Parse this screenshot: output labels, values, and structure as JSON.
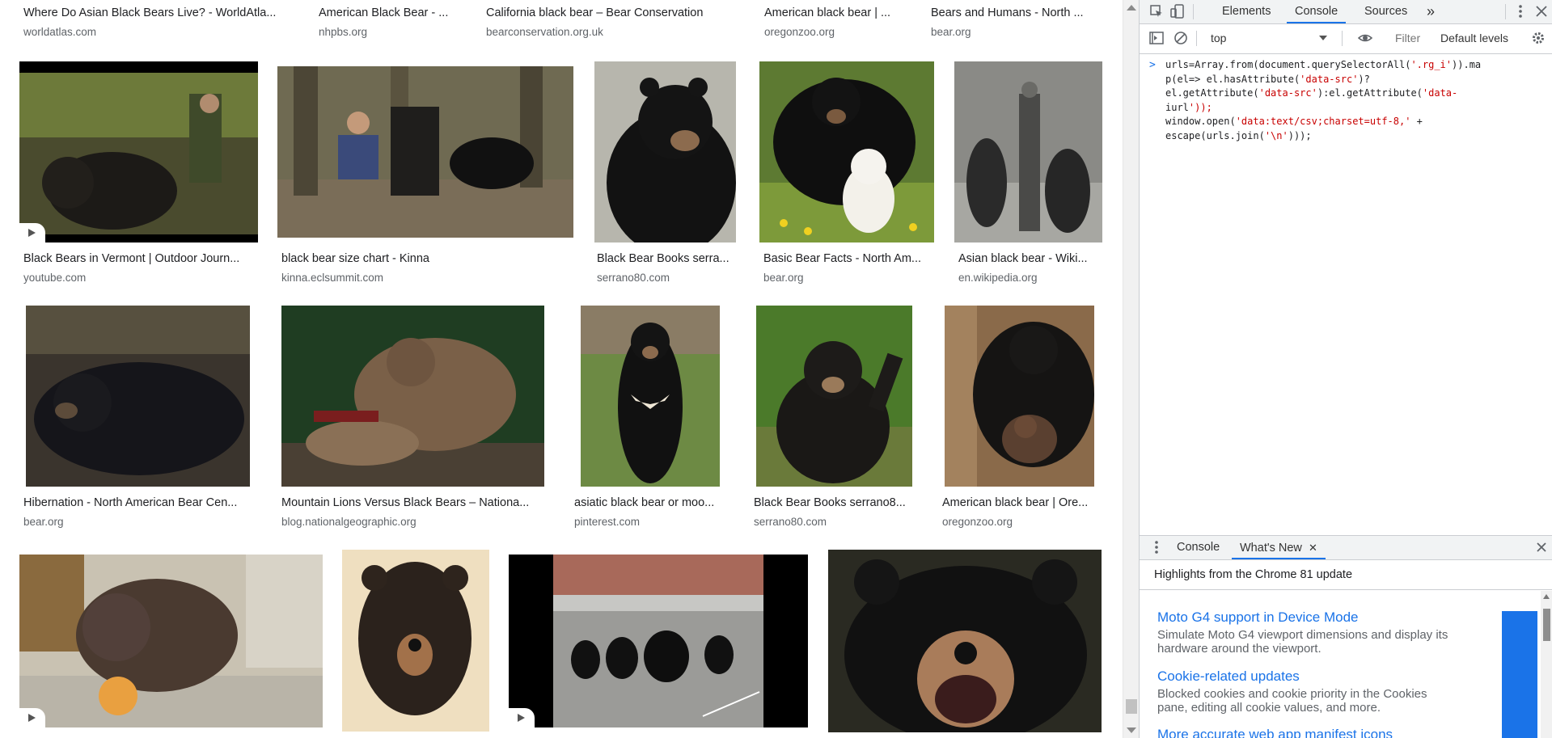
{
  "top_row": [
    {
      "title": "Where Do Asian Black Bears Live? - WorldAtla...",
      "domain": "worldatlas.com"
    },
    {
      "title": "American Black Bear - ...",
      "domain": "nhpbs.org"
    },
    {
      "title": "California black bear – Bear Conservation",
      "domain": "bearconservation.org.uk"
    },
    {
      "title": "American black bear | ...",
      "domain": "oregonzoo.org"
    },
    {
      "title": "Bears and Humans - North ...",
      "domain": "bear.org"
    }
  ],
  "row1": [
    {
      "title": "Black Bears in Vermont | Outdoor Journ...",
      "domain": "youtube.com",
      "video": true
    },
    {
      "title": "black bear size chart - Kinna",
      "domain": "kinna.eclsummit.com"
    },
    {
      "title": "Black Bear Books serra...",
      "domain": "serrano80.com"
    },
    {
      "title": "Basic Bear Facts - North Am...",
      "domain": "bear.org"
    },
    {
      "title": "Asian black bear - Wiki...",
      "domain": "en.wikipedia.org"
    }
  ],
  "row2": [
    {
      "title": "Hibernation - North American Bear Cen...",
      "domain": "bear.org"
    },
    {
      "title": "Mountain Lions Versus Black Bears – Nationa...",
      "domain": "blog.nationalgeographic.org"
    },
    {
      "title": "asiatic black bear or moo...",
      "domain": "pinterest.com"
    },
    {
      "title": "Black Bear Books serrano8...",
      "domain": "serrano80.com"
    },
    {
      "title": "American black bear | Ore...",
      "domain": "oregonzoo.org"
    }
  ],
  "row3": [
    {
      "video": true
    },
    {},
    {
      "video": true
    },
    {}
  ],
  "devtools": {
    "tabs": [
      "Elements",
      "Console",
      "Sources"
    ],
    "active_tab": "Console",
    "more_tabs_icon": "»",
    "context": "top",
    "filter_placeholder": "Filter",
    "levels": "Default levels",
    "prompt": ">",
    "code_lines": [
      "urls=Array.from(document.querySelectorAll('.rg_i')).ma",
      "p(el=> el.hasAttribute('data-src')?",
      "el.getAttribute('data-src'):el.getAttribute('data-",
      "iurl'));",
      "window.open('data:text/csv;charset=utf-8,' +",
      "escape(urls.join('\\n')));"
    ],
    "drawer_tabs": [
      "Console",
      "What's New"
    ],
    "drawer_active": "What's New",
    "whats_new_heading": "Highlights from the Chrome 81 update",
    "items": [
      {
        "title": "Moto G4 support in Device Mode",
        "desc": "Simulate Moto G4 viewport dimensions and display its hardware around the viewport."
      },
      {
        "title": "Cookie-related updates",
        "desc": "Blocked cookies and cookie priority in the Cookies pane, editing all cookie values, and more."
      },
      {
        "title": "More accurate web app manifest icons",
        "desc": ""
      }
    ]
  },
  "colors": {
    "accent": "#1a73e8",
    "string": "#c80000"
  }
}
